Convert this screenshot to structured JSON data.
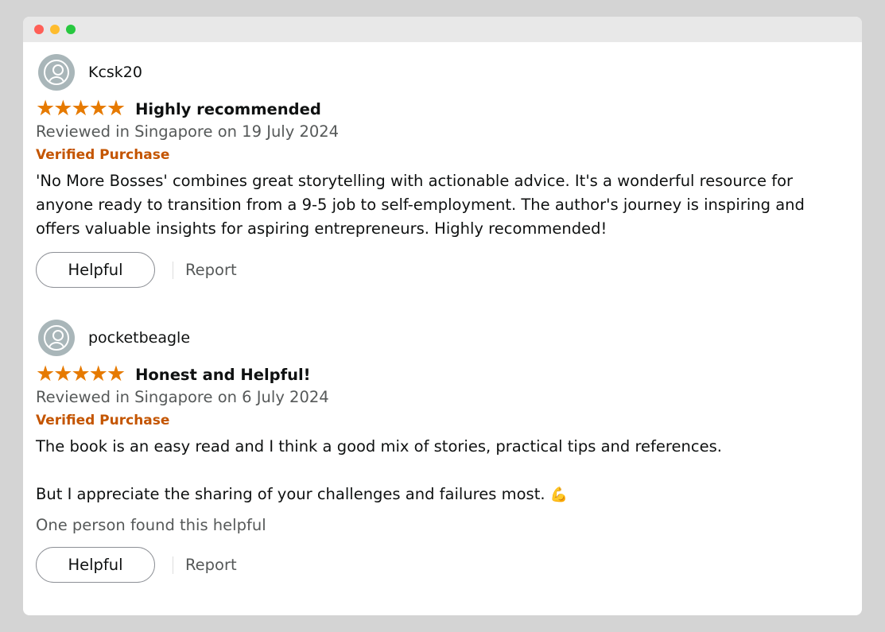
{
  "reviews": [
    {
      "username": "Kcsk20",
      "rating": 5,
      "title": "Highly recommended",
      "meta": "Reviewed in Singapore on 19 July 2024",
      "badge": "Verified Purchase",
      "body": "'No More Bosses' combines great storytelling with actionable advice. It's a wonderful resource for anyone ready to transition from a 9-5 job to self-employment. The author's journey is inspiring and offers valuable insights for aspiring entrepreneurs. Highly recommended!",
      "helpful_label": "Helpful",
      "report_label": "Report"
    },
    {
      "username": "pocketbeagle",
      "rating": 5,
      "title": "Honest and Helpful!",
      "meta": "Reviewed in Singapore on 6 July 2024",
      "badge": "Verified Purchase",
      "body_line1": "The book is an easy read and I think a good mix of stories, practical tips and references.",
      "body_line2": "But I appreciate the sharing of your challenges and failures most.",
      "body_emoji": "💪",
      "helpful_count": "One person found this helpful",
      "helpful_label": "Helpful",
      "report_label": "Report"
    }
  ],
  "colors": {
    "star": "#e67a00",
    "verified": "#c45500",
    "meta": "#565959"
  }
}
